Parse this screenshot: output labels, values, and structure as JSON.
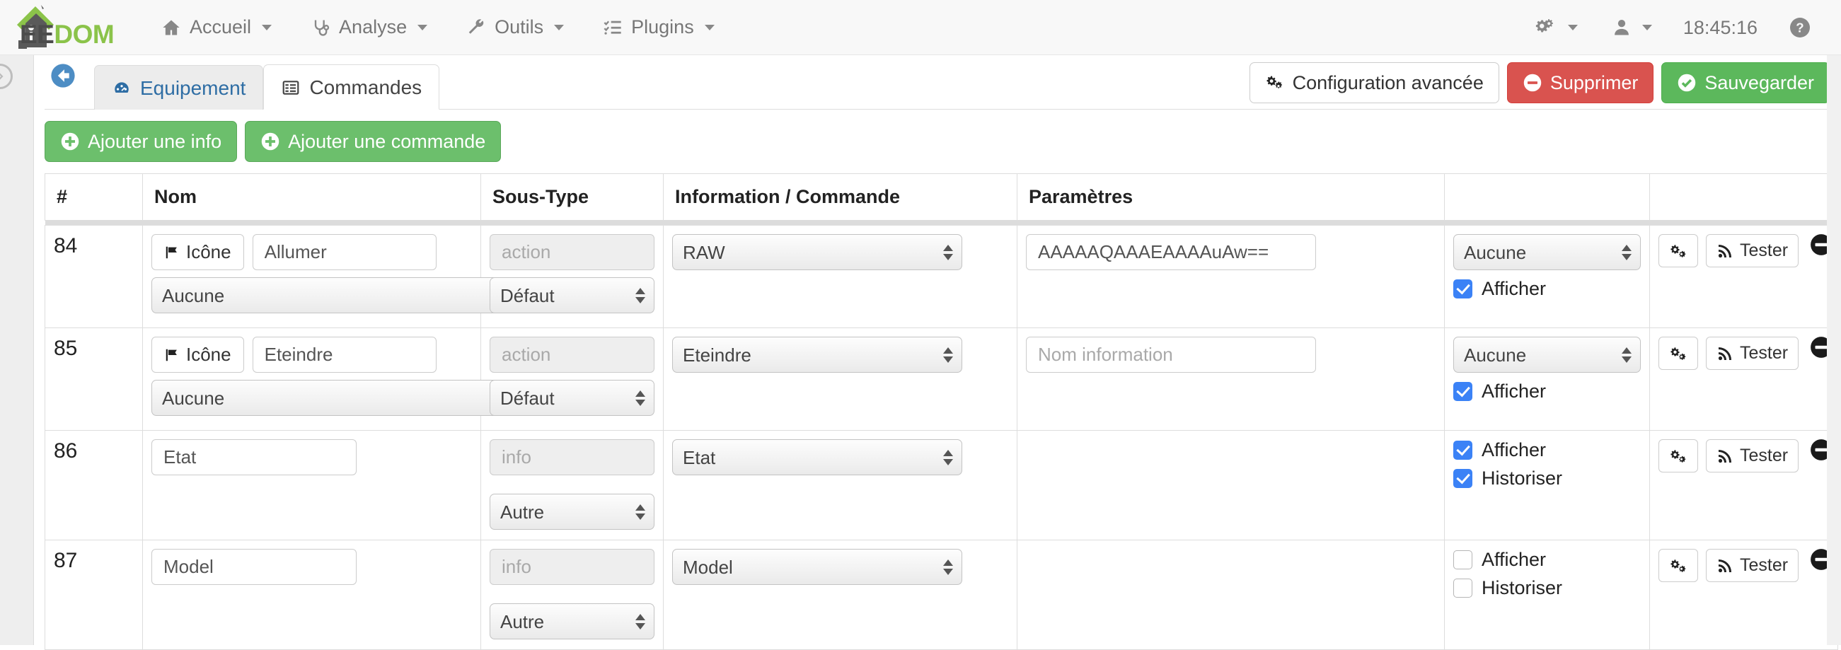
{
  "brand": {
    "dark": "EE",
    "green": "DOM",
    "logo_icon": "jeedom-house-logo"
  },
  "navbar": {
    "items": [
      {
        "label": "Accueil",
        "icon": "home-icon",
        "caret": true
      },
      {
        "label": "Analyse",
        "icon": "stethoscope-icon",
        "caret": true
      },
      {
        "label": "Outils",
        "icon": "wrench-icon",
        "caret": true
      },
      {
        "label": "Plugins",
        "icon": "list-check-icon",
        "caret": true
      }
    ],
    "right": {
      "gears_icon": "gears-icon",
      "user_icon": "user-icon",
      "clock": "18:45:16",
      "help_icon": "question-circle-icon"
    }
  },
  "toolbar": {
    "back_icon": "arrow-circle-left-icon",
    "tabs": [
      {
        "label": "Equipement",
        "icon": "dashboard-icon",
        "active": false
      },
      {
        "label": "Commandes",
        "icon": "table-list-icon",
        "active": true
      }
    ],
    "config_label": "Configuration avancée",
    "config_icon": "gears-icon",
    "delete_label": "Supprimer",
    "delete_icon": "minus-circle-icon",
    "save_label": "Sauvegarder",
    "save_icon": "check-circle-icon",
    "add_info_label": "Ajouter une info",
    "add_command_label": "Ajouter une commande",
    "add_icon": "plus-circle-icon"
  },
  "table": {
    "headers": [
      "#",
      "Nom",
      "Sous-Type",
      "Information / Commande",
      "Paramètres",
      "",
      ""
    ],
    "rows": [
      {
        "id": "84",
        "icon_button": "Icône",
        "icon_button_glyph": "flag-icon",
        "name_value": "Allumer",
        "name_placeholder": "",
        "icon_select": "Aucune",
        "subtype_placeholder": "action",
        "subtype_select": "Défaut",
        "subtype_disabled": true,
        "info_select": "RAW",
        "param_value": "AAAAAQAAAEAAAAuAw==",
        "param_placeholder": "",
        "param_disabled": false,
        "opt_select": "Aucune",
        "checkboxes": [
          {
            "label": "Afficher",
            "checked": true
          }
        ],
        "gear_icon": "gears-icon",
        "test_label": "Tester",
        "test_icon": "rss-icon",
        "remove_icon": "minus-circle-icon"
      },
      {
        "id": "85",
        "icon_button": "Icône",
        "icon_button_glyph": "flag-icon",
        "name_value": "Eteindre",
        "name_placeholder": "",
        "icon_select": "Aucune",
        "subtype_placeholder": "action",
        "subtype_select": "Défaut",
        "subtype_disabled": true,
        "info_select": "Eteindre",
        "param_value": "",
        "param_placeholder": "Nom information",
        "param_disabled": false,
        "opt_select": "Aucune",
        "checkboxes": [
          {
            "label": "Afficher",
            "checked": true
          }
        ],
        "gear_icon": "gears-icon",
        "test_label": "Tester",
        "test_icon": "rss-icon",
        "remove_icon": "minus-circle-icon"
      },
      {
        "id": "86",
        "icon_button": "",
        "icon_button_glyph": "",
        "name_value": "Etat",
        "name_placeholder": "",
        "icon_select": "",
        "subtype_placeholder": "info",
        "subtype_select": "Autre",
        "subtype_disabled": true,
        "info_select": "Etat",
        "param_value": "",
        "param_placeholder": "",
        "param_disabled": false,
        "opt_select": "",
        "checkboxes": [
          {
            "label": "Afficher",
            "checked": true
          },
          {
            "label": "Historiser",
            "checked": true
          }
        ],
        "gear_icon": "gears-icon",
        "test_label": "Tester",
        "test_icon": "rss-icon",
        "remove_icon": "minus-circle-icon"
      },
      {
        "id": "87",
        "icon_button": "",
        "icon_button_glyph": "",
        "name_value": "Model",
        "name_placeholder": "",
        "icon_select": "",
        "subtype_placeholder": "info",
        "subtype_select": "Autre",
        "subtype_disabled": true,
        "info_select": "Model",
        "param_value": "",
        "param_placeholder": "",
        "param_disabled": false,
        "opt_select": "",
        "checkboxes": [
          {
            "label": "Afficher",
            "checked": false
          },
          {
            "label": "Historiser",
            "checked": false
          }
        ],
        "gear_icon": "gears-icon",
        "test_label": "Tester",
        "test_icon": "rss-icon",
        "remove_icon": "minus-circle-icon"
      }
    ]
  },
  "colors": {
    "brand_green": "#8bc34a",
    "success": "#5cb85c",
    "danger": "#d9534f",
    "link": "#2e6da4",
    "checkbox_on": "#3b82f6"
  }
}
